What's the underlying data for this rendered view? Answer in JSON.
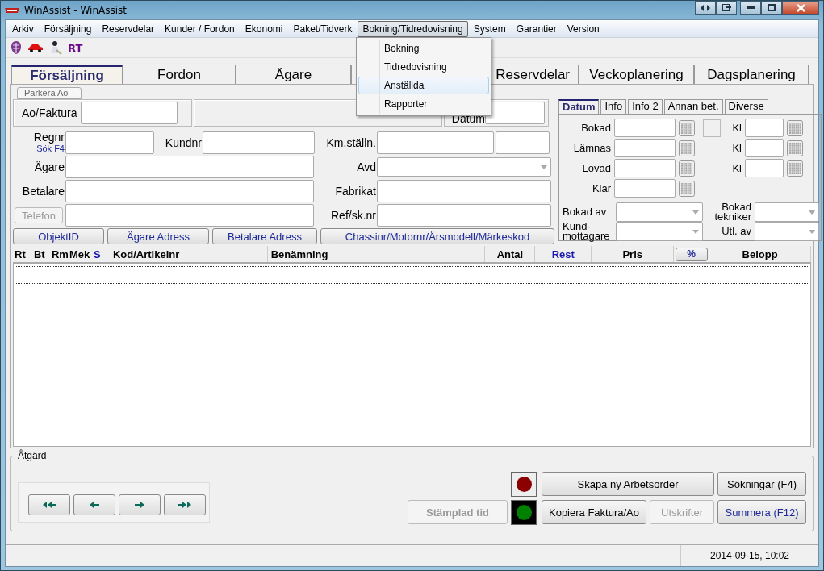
{
  "window": {
    "title": "WinAssist - WinAssist"
  },
  "menu": [
    {
      "label": "Arkiv",
      "selected": false
    },
    {
      "label": "Försäljning",
      "selected": false
    },
    {
      "label": "Reservdelar",
      "selected": false
    },
    {
      "label": "Kunder / Fordon",
      "selected": false
    },
    {
      "label": "Ekonomi",
      "selected": false
    },
    {
      "label": "Paket/Tidverk",
      "selected": false
    },
    {
      "label": "Bokning/Tidredovisning",
      "selected": true
    },
    {
      "label": "System",
      "selected": false
    },
    {
      "label": "Garantier",
      "selected": false
    },
    {
      "label": "Version",
      "selected": false
    }
  ],
  "dropdown": [
    {
      "label": "Bokning",
      "selected": false
    },
    {
      "label": "Tidredovisning",
      "selected": false
    },
    {
      "label": "Anställda",
      "selected": true
    },
    {
      "label": "Rapporter",
      "selected": false
    }
  ],
  "toolbar": {
    "label": "RT"
  },
  "tabs": [
    {
      "label": "Försäljning",
      "selected": true
    },
    {
      "label": "Fordon",
      "selected": false
    },
    {
      "label": "Ägare",
      "selected": false
    },
    {
      "label": "Reservdelar",
      "selected": false
    },
    {
      "label": "Veckoplanering",
      "selected": false
    },
    {
      "label": "Dagsplanering",
      "selected": false
    }
  ],
  "park_button": {
    "label": "Parkera Ao"
  },
  "order": {
    "label": "Ao/Faktura",
    "date_label": "Datum"
  },
  "customer": {
    "regnr_label": "Regnr",
    "regnr_hint": "Sök F4",
    "kundnr_label": "Kundnr",
    "owner_label": "Ägare",
    "payer_label": "Betalare",
    "phone_button": {
      "label": "Telefon",
      "disabled": true
    }
  },
  "vehicle": {
    "km_label": "Km.ställn.",
    "dept_label": "Avd",
    "make_label": "Fabrikat",
    "ref_label": "Ref/sk.nr"
  },
  "link_buttons": [
    "ObjektID",
    "Ägare Adress",
    "Betalare Adress",
    "Chassinr/Motornr/Årsmodell/Märkeskod"
  ],
  "side_tabs": [
    {
      "label": "Datum",
      "selected": true
    },
    {
      "label": "Info",
      "selected": false
    },
    {
      "label": "Info 2",
      "selected": false
    },
    {
      "label": "Annan bet.",
      "selected": false
    },
    {
      "label": "Diverse",
      "selected": false
    }
  ],
  "dates": [
    {
      "label": "Bokad",
      "kl_label": "Kl",
      "checked": false
    },
    {
      "label": "Lämnas",
      "kl_label": "Kl"
    },
    {
      "label": "Lovad",
      "kl_label": "Kl"
    },
    {
      "label": "Klar"
    }
  ],
  "staff": [
    {
      "label": "Bokad av",
      "right_label": "Bokad tekniker"
    },
    {
      "label": "Kund-mottagare",
      "right_label": "Utl. av"
    }
  ],
  "table": {
    "columns": [
      {
        "label": "Rt",
        "kind": "text",
        "highlight": false
      },
      {
        "label": "Bt",
        "kind": "text",
        "highlight": false
      },
      {
        "label": "Rm",
        "kind": "text",
        "highlight": false
      },
      {
        "label": "Mek",
        "kind": "text",
        "highlight": false
      },
      {
        "label": "S",
        "kind": "text",
        "highlight": true
      },
      {
        "label": "Kod/Artikelnr",
        "kind": "text",
        "highlight": false
      },
      {
        "label": "Benämning",
        "kind": "text",
        "highlight": false
      },
      {
        "label": "Antal",
        "kind": "text",
        "highlight": false
      },
      {
        "label": "Rest",
        "kind": "text",
        "highlight": true
      },
      {
        "label": "Pris",
        "kind": "text",
        "highlight": false
      },
      {
        "label": "%",
        "kind": "button",
        "highlight": true
      },
      {
        "label": "Belopp",
        "kind": "text",
        "highlight": false
      }
    ]
  },
  "actions": {
    "title": "Åtgärd",
    "stamp_button": {
      "label": "Stämplad tid",
      "disabled": true
    },
    "lights": [
      {
        "color": "#8b0000",
        "on": false
      },
      {
        "color": "#008000",
        "on": true
      }
    ],
    "buttons": [
      {
        "label": "Skapa ny Arbetsorder",
        "disabled": false,
        "highlight": false
      },
      {
        "label": "Sökningar (F4)",
        "disabled": false,
        "highlight": false
      },
      {
        "label": "Kopiera Faktura/Ao",
        "disabled": false,
        "highlight": false
      },
      {
        "label": "Utskrifter",
        "disabled": true,
        "highlight": false
      },
      {
        "label": "Summera (F12)",
        "disabled": false,
        "highlight": true
      }
    ]
  },
  "status_bar": {
    "datetime": "2014-09-15, 10:02"
  }
}
